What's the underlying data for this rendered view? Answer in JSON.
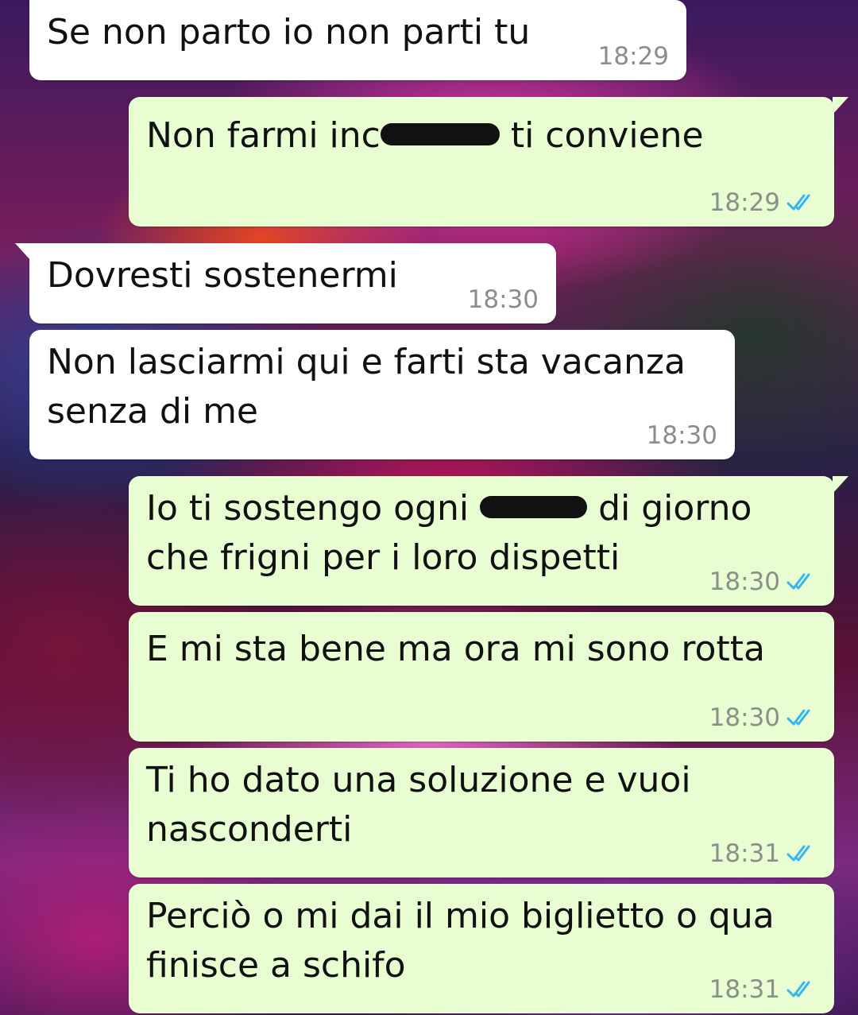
{
  "colors": {
    "incoming_bubble": "#ffffff",
    "outgoing_bubble": "#e9fdd3",
    "read_ticks": "#34b7f1",
    "timestamp": "#8a8f8a"
  },
  "messages": [
    {
      "direction": "in",
      "text": "Se non parto io non parti tu",
      "time": "18:29"
    },
    {
      "direction": "out",
      "text_before": "Non farmi inc",
      "text_after": " ti conviene",
      "redacted": true,
      "time": "18:29",
      "status": "read"
    },
    {
      "direction": "in",
      "text": "Dovresti sostenermi",
      "time": "18:30"
    },
    {
      "direction": "in",
      "text": "Non lasciarmi qui e farti sta vacanza senza di me",
      "time": "18:30"
    },
    {
      "direction": "out",
      "text_before": "Io ti sostengo ogni ",
      "text_after": " di giorno che frigni per i loro dispetti",
      "redacted": true,
      "time": "18:30",
      "status": "read"
    },
    {
      "direction": "out",
      "text": "E mi sta bene ma ora mi sono rotta",
      "time": "18:30",
      "status": "read"
    },
    {
      "direction": "out",
      "text": "Ti ho dato una soluzione e vuoi nasconderti",
      "time": "18:31",
      "status": "read"
    },
    {
      "direction": "out",
      "text": "Perciò o mi dai il mio biglietto o qua finisce a schifo",
      "time": "18:31",
      "status": "read"
    }
  ]
}
